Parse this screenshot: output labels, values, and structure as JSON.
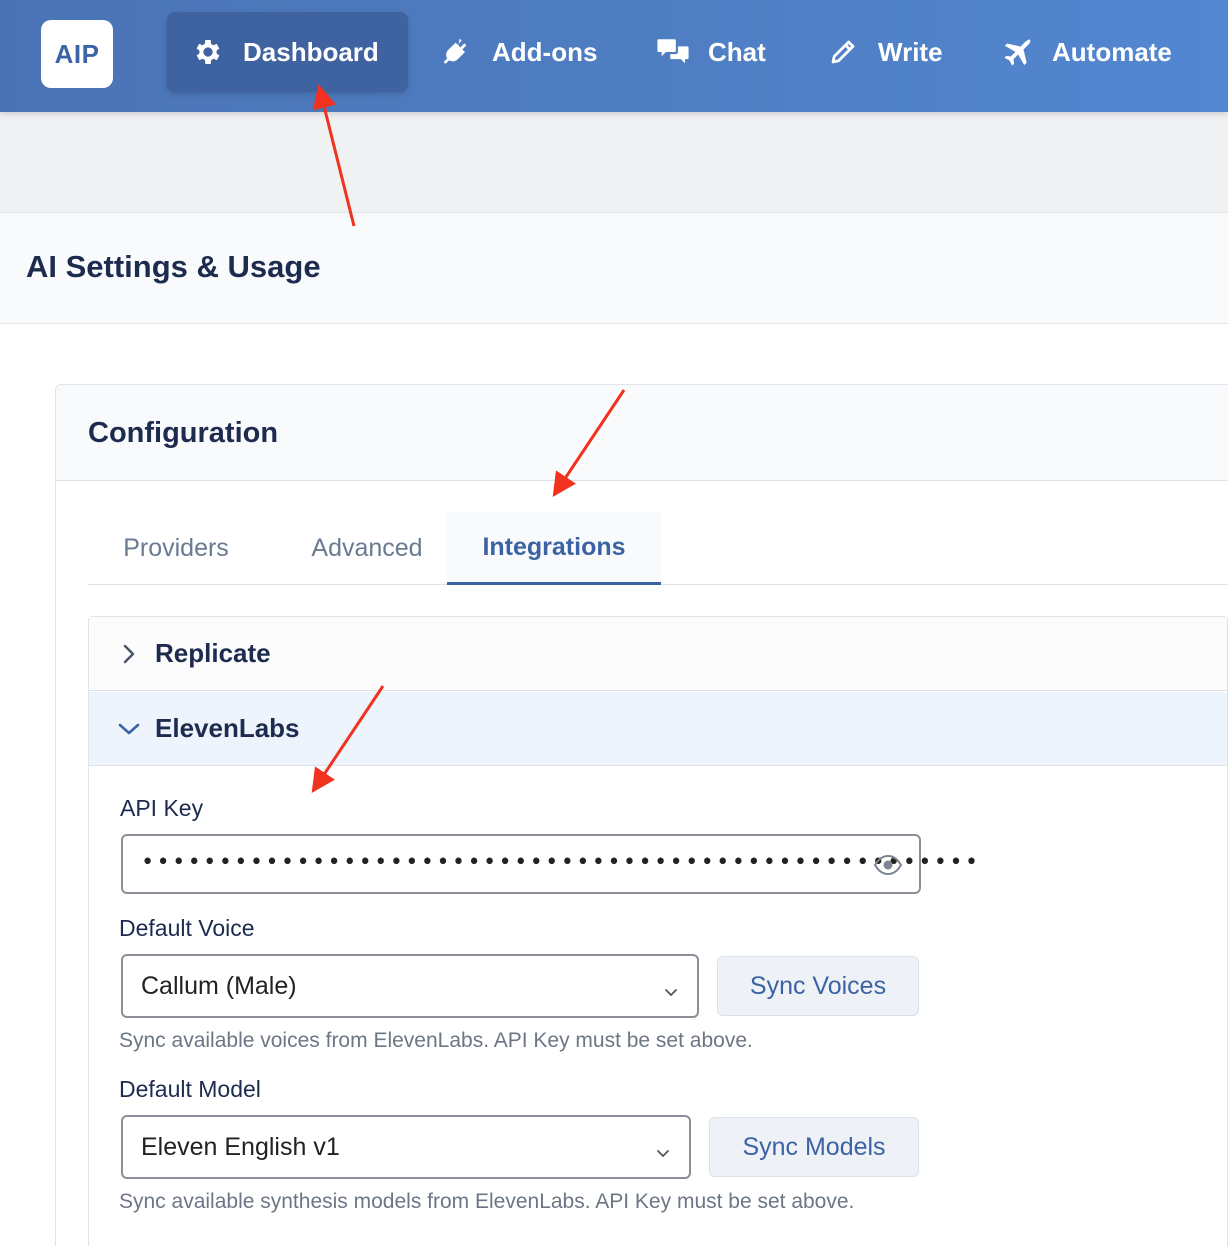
{
  "nav": {
    "logo": "AIP",
    "items": [
      {
        "label": "Dashboard",
        "icon": "gear-icon",
        "active": true
      },
      {
        "label": "Add-ons",
        "icon": "plug-icon",
        "active": false
      },
      {
        "label": "Chat",
        "icon": "chat-bubbles-icon",
        "active": false
      },
      {
        "label": "Write",
        "icon": "pencil-icon",
        "active": false
      },
      {
        "label": "Automate",
        "icon": "plane-icon",
        "active": false
      }
    ]
  },
  "page": {
    "title": "AI Settings & Usage"
  },
  "config": {
    "title": "Configuration",
    "tabs": [
      {
        "label": "Providers",
        "active": false
      },
      {
        "label": "Advanced",
        "active": false
      },
      {
        "label": "Integrations",
        "active": true
      }
    ],
    "sections": [
      {
        "label": "Replicate",
        "expanded": false
      },
      {
        "label": "ElevenLabs",
        "expanded": true
      }
    ],
    "elevenlabs": {
      "api_key_label": "API Key",
      "api_key_value": "••••••••••••••••••••••••••••••••••••••••••••••••••••••",
      "voice_label": "Default Voice",
      "voice_value": "Callum (Male)",
      "sync_voices_label": "Sync Voices",
      "voice_help": "Sync available voices from ElevenLabs. API Key must be set above.",
      "model_label": "Default Model",
      "model_value": "Eleven English v1",
      "sync_models_label": "Sync Models",
      "model_help": "Sync available synthesis models from ElevenLabs. API Key must be set above."
    }
  },
  "colors": {
    "nav_start": "#4a73b5",
    "nav_end": "#5387d1",
    "accent": "#3b63a4",
    "annotation_arrow": "#f0321e"
  }
}
